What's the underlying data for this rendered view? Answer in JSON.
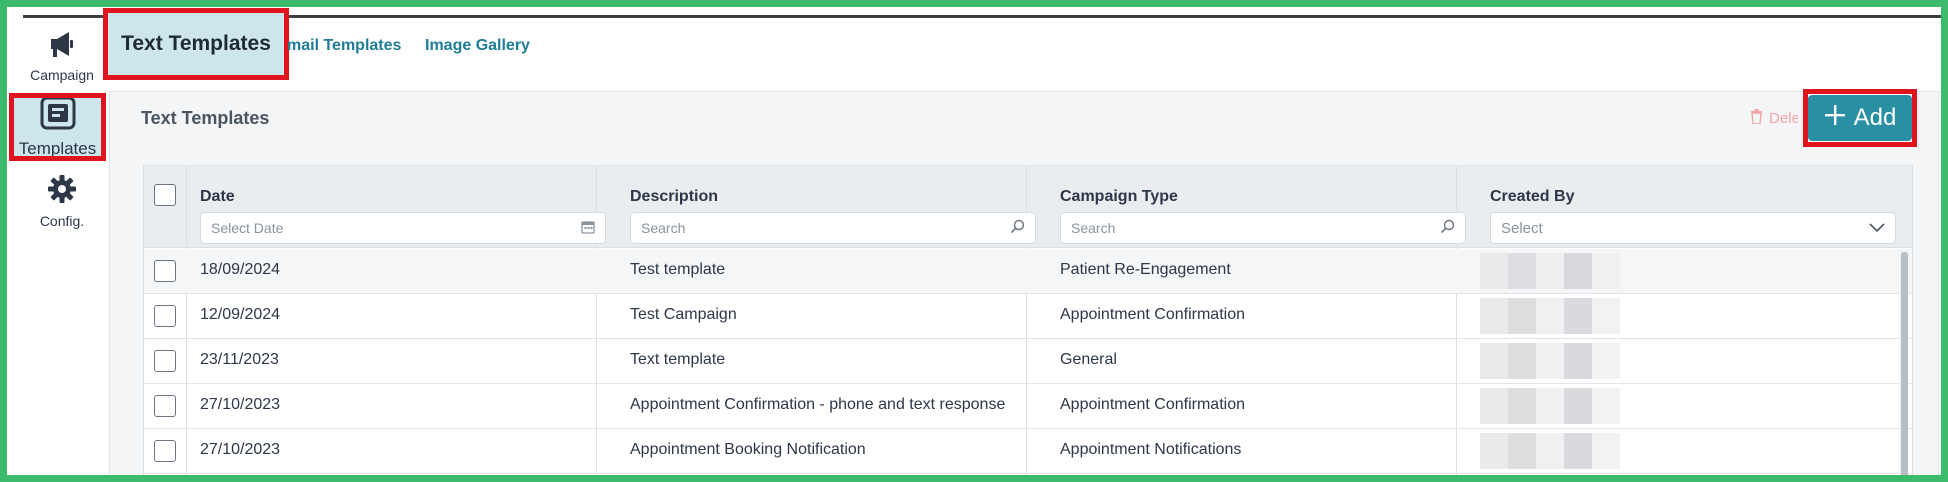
{
  "sidebar": {
    "items": [
      {
        "label": "Campaign",
        "icon": "megaphone-icon"
      },
      {
        "label": "Templates",
        "icon": "templates-icon"
      },
      {
        "label": "Config.",
        "icon": "gear-icon"
      }
    ]
  },
  "tabs": {
    "active": "Text Templates",
    "email": "mail Templates",
    "gallery": "Image Gallery"
  },
  "panel": {
    "title": "Text Templates",
    "delete_label": "Delete",
    "add_label": "Add"
  },
  "table": {
    "columns": [
      {
        "label": "Date",
        "placeholder": "Select Date"
      },
      {
        "label": "Description",
        "placeholder": "Search"
      },
      {
        "label": "Campaign Type",
        "placeholder": "Search"
      },
      {
        "label": "Created By",
        "placeholder": "Select"
      }
    ],
    "rows": [
      {
        "date": "18/09/2024",
        "description": "Test template",
        "type": "Patient Re-Engagement"
      },
      {
        "date": "12/09/2024",
        "description": "Test Campaign",
        "type": "Appointment Confirmation"
      },
      {
        "date": "23/11/2023",
        "description": "Text template",
        "type": "General"
      },
      {
        "date": "27/10/2023",
        "description": "Appointment Confirmation - phone and text response",
        "type": "Appointment Confirmation"
      },
      {
        "date": "27/10/2023",
        "description": "Appointment Booking Notification",
        "type": "Appointment Notifications"
      }
    ]
  },
  "colors": {
    "accent": "#2a8fa3",
    "highlight": "#e0141e",
    "active_bg": "#cde6ec",
    "frame": "#3dbb6c"
  }
}
